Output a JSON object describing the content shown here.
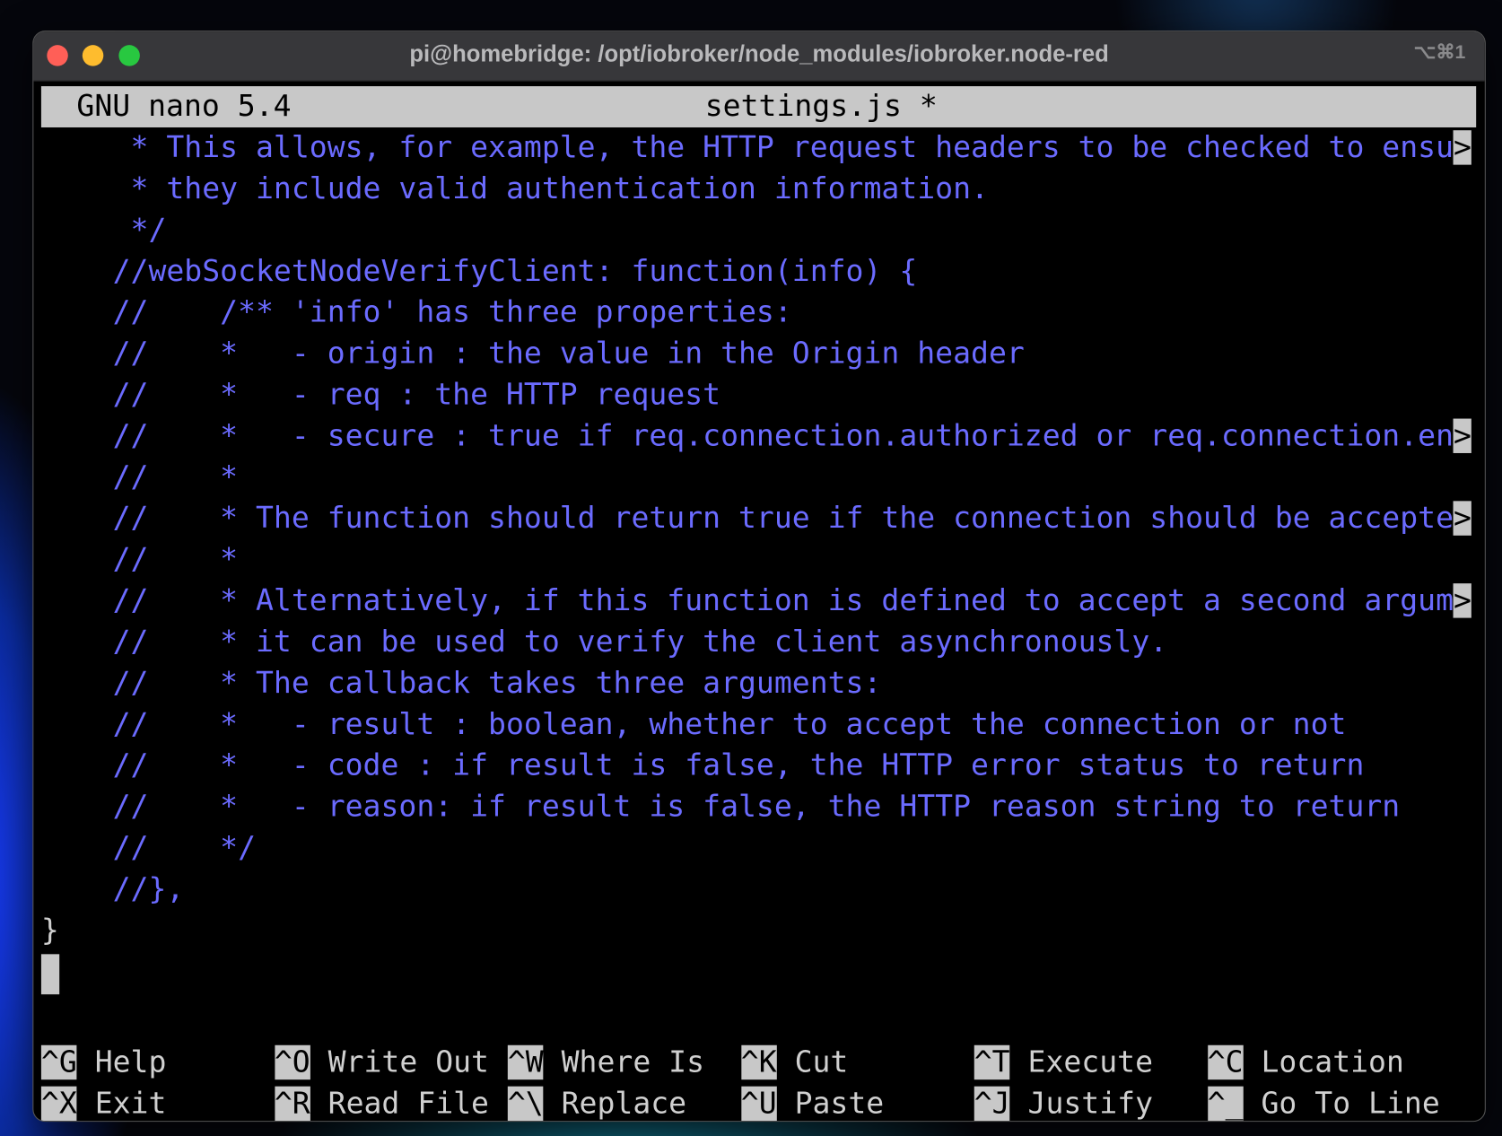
{
  "window": {
    "title": "pi@homebridge: /opt/iobroker/node_modules/iobroker.node-red",
    "shortcut_hint": "⌥⌘1",
    "traffic_lights": {
      "close": "#ff5f57",
      "minimize": "#febc2e",
      "zoom": "#28c840"
    }
  },
  "nano": {
    "version": "GNU nano 5.4",
    "filename": "settings.js *",
    "text_color": "#6b6bff",
    "lines": [
      {
        "text": "     * This allows, for example, the HTTP request headers to be checked to ensu",
        "overflow": ">"
      },
      {
        "text": "     * they include valid authentication information."
      },
      {
        "text": "     */"
      },
      {
        "text": "    //webSocketNodeVerifyClient: function(info) {"
      },
      {
        "text": "    //    /** 'info' has three properties:"
      },
      {
        "text": "    //    *   - origin : the value in the Origin header"
      },
      {
        "text": "    //    *   - req : the HTTP request"
      },
      {
        "text": "    //    *   - secure : true if req.connection.authorized or req.connection.en",
        "overflow": ">"
      },
      {
        "text": "    //    *"
      },
      {
        "text": "    //    * The function should return true if the connection should be accepte",
        "overflow": ">"
      },
      {
        "text": "    //    *"
      },
      {
        "text": "    //    * Alternatively, if this function is defined to accept a second argum",
        "overflow": ">"
      },
      {
        "text": "    //    * it can be used to verify the client asynchronously."
      },
      {
        "text": "    //    * The callback takes three arguments:"
      },
      {
        "text": "    //    *   - result : boolean, whether to accept the connection or not"
      },
      {
        "text": "    //    *   - code : if result is false, the HTTP error status to return"
      },
      {
        "text": "    //    *   - reason: if result is false, the HTTP reason string to return"
      },
      {
        "text": "    //    */"
      },
      {
        "text": "    //},"
      },
      {
        "text": "}",
        "plain": true
      }
    ],
    "shortcuts": [
      [
        {
          "key": "^G",
          "label": "Help"
        },
        {
          "key": "^X",
          "label": "Exit"
        }
      ],
      [
        {
          "key": "^O",
          "label": "Write Out"
        },
        {
          "key": "^R",
          "label": "Read File"
        }
      ],
      [
        {
          "key": "^W",
          "label": "Where Is"
        },
        {
          "key": "^\\",
          "label": "Replace"
        }
      ],
      [
        {
          "key": "^K",
          "label": "Cut"
        },
        {
          "key": "^U",
          "label": "Paste"
        }
      ],
      [
        {
          "key": "^T",
          "label": "Execute"
        },
        {
          "key": "^J",
          "label": "Justify"
        }
      ],
      [
        {
          "key": "^C",
          "label": "Location"
        },
        {
          "key": "^_",
          "label": "Go To Line"
        }
      ]
    ]
  }
}
